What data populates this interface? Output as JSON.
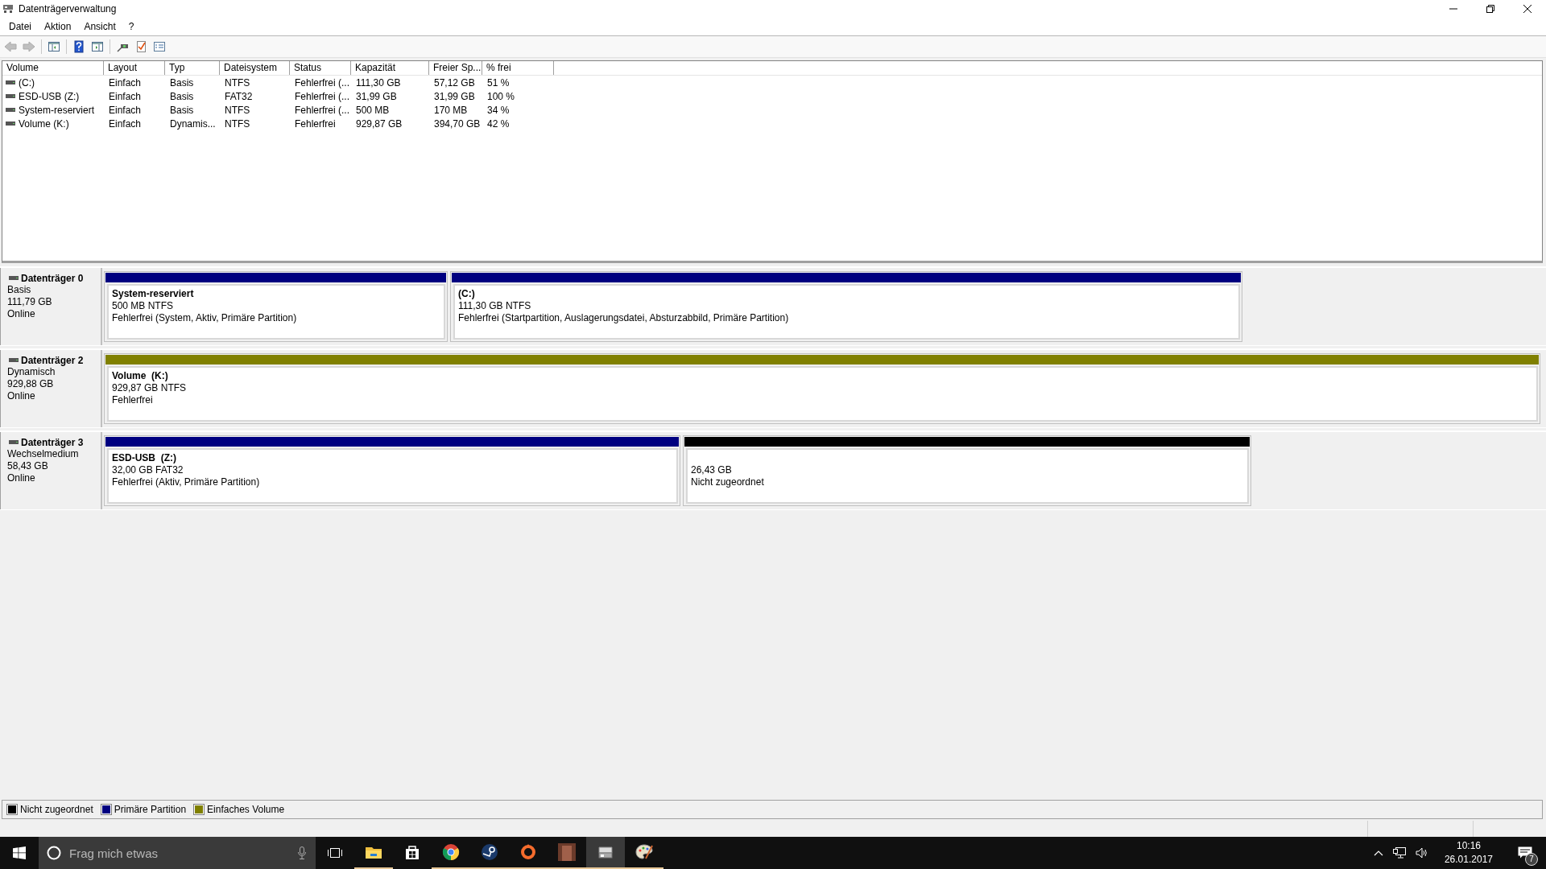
{
  "window": {
    "title": "Datenträgerverwaltung"
  },
  "menu": [
    "Datei",
    "Aktion",
    "Ansicht",
    "?"
  ],
  "toolbar": [
    {
      "kind": "back",
      "disabled": true
    },
    {
      "kind": "forward",
      "disabled": true
    },
    {
      "kind": "separator"
    },
    {
      "kind": "tree",
      "disabled": false
    },
    {
      "kind": "separator"
    },
    {
      "kind": "help",
      "disabled": false
    },
    {
      "kind": "pane",
      "disabled": false
    },
    {
      "kind": "separator"
    },
    {
      "kind": "connect",
      "disabled": false
    },
    {
      "kind": "check",
      "disabled": false
    },
    {
      "kind": "properties",
      "disabled": false
    }
  ],
  "table": {
    "columns": [
      "Volume",
      "Layout",
      "Typ",
      "Dateisystem",
      "Status",
      "Kapazität",
      "Freier Sp...",
      "% frei"
    ],
    "rows": [
      [
        "(C:)",
        "Einfach",
        "Basis",
        "NTFS",
        "Fehlerfrei (...",
        "111,30 GB",
        "57,12 GB",
        "51 %"
      ],
      [
        "ESD-USB (Z:)",
        "Einfach",
        "Basis",
        "FAT32",
        "Fehlerfrei (...",
        "31,99 GB",
        "31,99 GB",
        "100 %"
      ],
      [
        "System-reserviert",
        "Einfach",
        "Basis",
        "NTFS",
        "Fehlerfrei (...",
        "500 MB",
        "170 MB",
        "34 %"
      ],
      [
        "Volume (K:)",
        "Einfach",
        "Dynamis...",
        "NTFS",
        "Fehlerfrei",
        "929,87 GB",
        "394,70 GB",
        "42 %"
      ]
    ]
  },
  "disks": [
    {
      "name": "Datenträger 0",
      "type": "Basis",
      "size": "111,79 GB",
      "state": "Online",
      "partitions": [
        {
          "kind": "primary",
          "name": "System-reserviert",
          "size": "500 MB NTFS",
          "status": "Fehlerfrei (System, Aktiv, Primäre Partition)"
        },
        {
          "kind": "primary",
          "name": "(C:)",
          "size": "111,30 GB NTFS",
          "status": "Fehlerfrei (Startpartition, Auslagerungsdatei, Absturzabbild, Primäre Partition)"
        }
      ]
    },
    {
      "name": "Datenträger 2",
      "type": "Dynamisch",
      "size": "929,88 GB",
      "state": "Online",
      "partitions": [
        {
          "kind": "simple",
          "name": "Volume  (K:)",
          "size": "929,87 GB NTFS",
          "status": "Fehlerfrei"
        }
      ]
    },
    {
      "name": "Datenträger 3",
      "type": "Wechselmedium",
      "size": "58,43 GB",
      "state": "Online",
      "partitions": [
        {
          "kind": "primary",
          "name": "ESD-USB  (Z:)",
          "size": "32,00 GB FAT32",
          "status": "Fehlerfrei (Aktiv, Primäre Partition)"
        },
        {
          "kind": "unallocated",
          "size": "26,43 GB",
          "status": "Nicht zugeordnet"
        }
      ]
    }
  ],
  "legend": [
    {
      "label": "Nicht zugeordnet",
      "color": "#000000"
    },
    {
      "label": "Primäre Partition",
      "color": "#000080"
    },
    {
      "label": "Einfaches Volume",
      "color": "#808000"
    }
  ],
  "taskbar": {
    "search": {
      "placeholder": "Frag mich etwas"
    },
    "apps": [
      {
        "kind": "explorer",
        "running": true,
        "active": false
      },
      {
        "kind": "store",
        "running": false,
        "active": false
      },
      {
        "kind": "chrome",
        "running": true,
        "active": false
      },
      {
        "kind": "steam",
        "running": true,
        "active": false
      },
      {
        "kind": "origin",
        "running": true,
        "active": false
      },
      {
        "kind": "game",
        "running": true,
        "active": false
      },
      {
        "kind": "diskmgmt",
        "running": true,
        "active": true
      },
      {
        "kind": "paint",
        "running": true,
        "active": false
      }
    ],
    "time": "10:16",
    "date": "26.01.2017",
    "notifications": "7"
  }
}
